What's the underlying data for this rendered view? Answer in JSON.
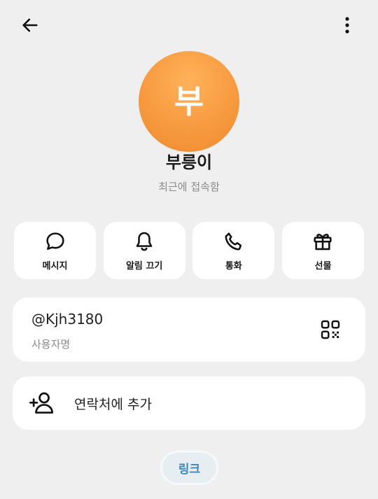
{
  "header": {
    "back_icon": "arrow-left-icon",
    "more_icon": "more-vertical-icon"
  },
  "profile": {
    "avatar_letter": "부",
    "avatar_color": "#f79a3f",
    "name": "부릉이",
    "status": "최근에 접속함"
  },
  "actions": [
    {
      "label": "메시지",
      "icon": "chat-bubble-icon"
    },
    {
      "label": "알림 끄기",
      "icon": "bell-icon"
    },
    {
      "label": "통화",
      "icon": "phone-icon"
    },
    {
      "label": "선물",
      "icon": "gift-icon"
    }
  ],
  "username": {
    "value": "@Kjh3180",
    "label": "사용자명",
    "icon": "qr-code-icon"
  },
  "add_contact": {
    "label": "연락처에 추가",
    "icon": "add-person-icon"
  },
  "link_chip": {
    "label": "링크",
    "color": "#3b88bb"
  }
}
